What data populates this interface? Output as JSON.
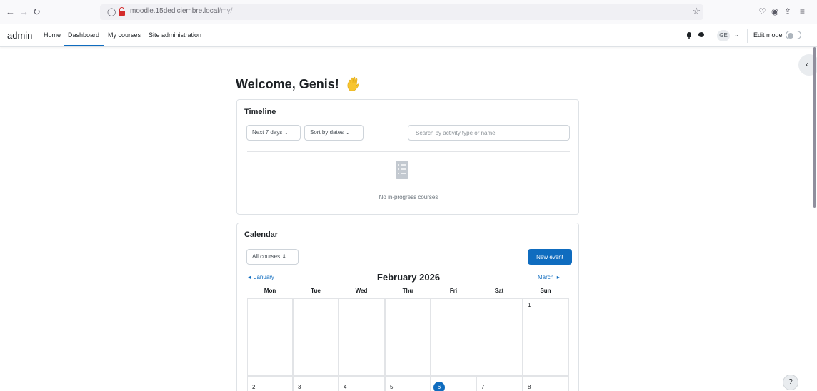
{
  "browser": {
    "url_host": "moodle.15dediciembre.local",
    "url_path": "/my/"
  },
  "navbar": {
    "brand": "admin",
    "links": [
      "Home",
      "Dashboard",
      "My courses",
      "Site administration"
    ],
    "active_link": "Dashboard",
    "user_initials": "GE",
    "edit_mode_label": "Edit mode",
    "edit_mode_on": false
  },
  "main": {
    "welcome": "Welcome, Genis!",
    "welcome_emoji": "waving-hand"
  },
  "timeline": {
    "title": "Timeline",
    "filter_label": "Next 7 days",
    "sort_label": "Sort by dates",
    "search_placeholder": "Search by activity type or name",
    "empty_text": "No in-progress courses"
  },
  "calendar": {
    "title": "Calendar",
    "course_filter": "All courses",
    "new_event_label": "New event",
    "prev_month": "January",
    "next_month": "March",
    "month_title": "February 2026",
    "day_headers": [
      "Mon",
      "Tue",
      "Wed",
      "Thu",
      "Fri",
      "Sat",
      "Sun"
    ],
    "week1": [
      "",
      "",
      "",
      "",
      "",
      "",
      "1"
    ],
    "week2": [
      "2",
      "3",
      "4",
      "5",
      "6",
      "7",
      "8"
    ],
    "today": "6"
  },
  "colors": {
    "primary": "#0f6cbf",
    "text": "#1d2125",
    "border": "#dee2e6"
  }
}
